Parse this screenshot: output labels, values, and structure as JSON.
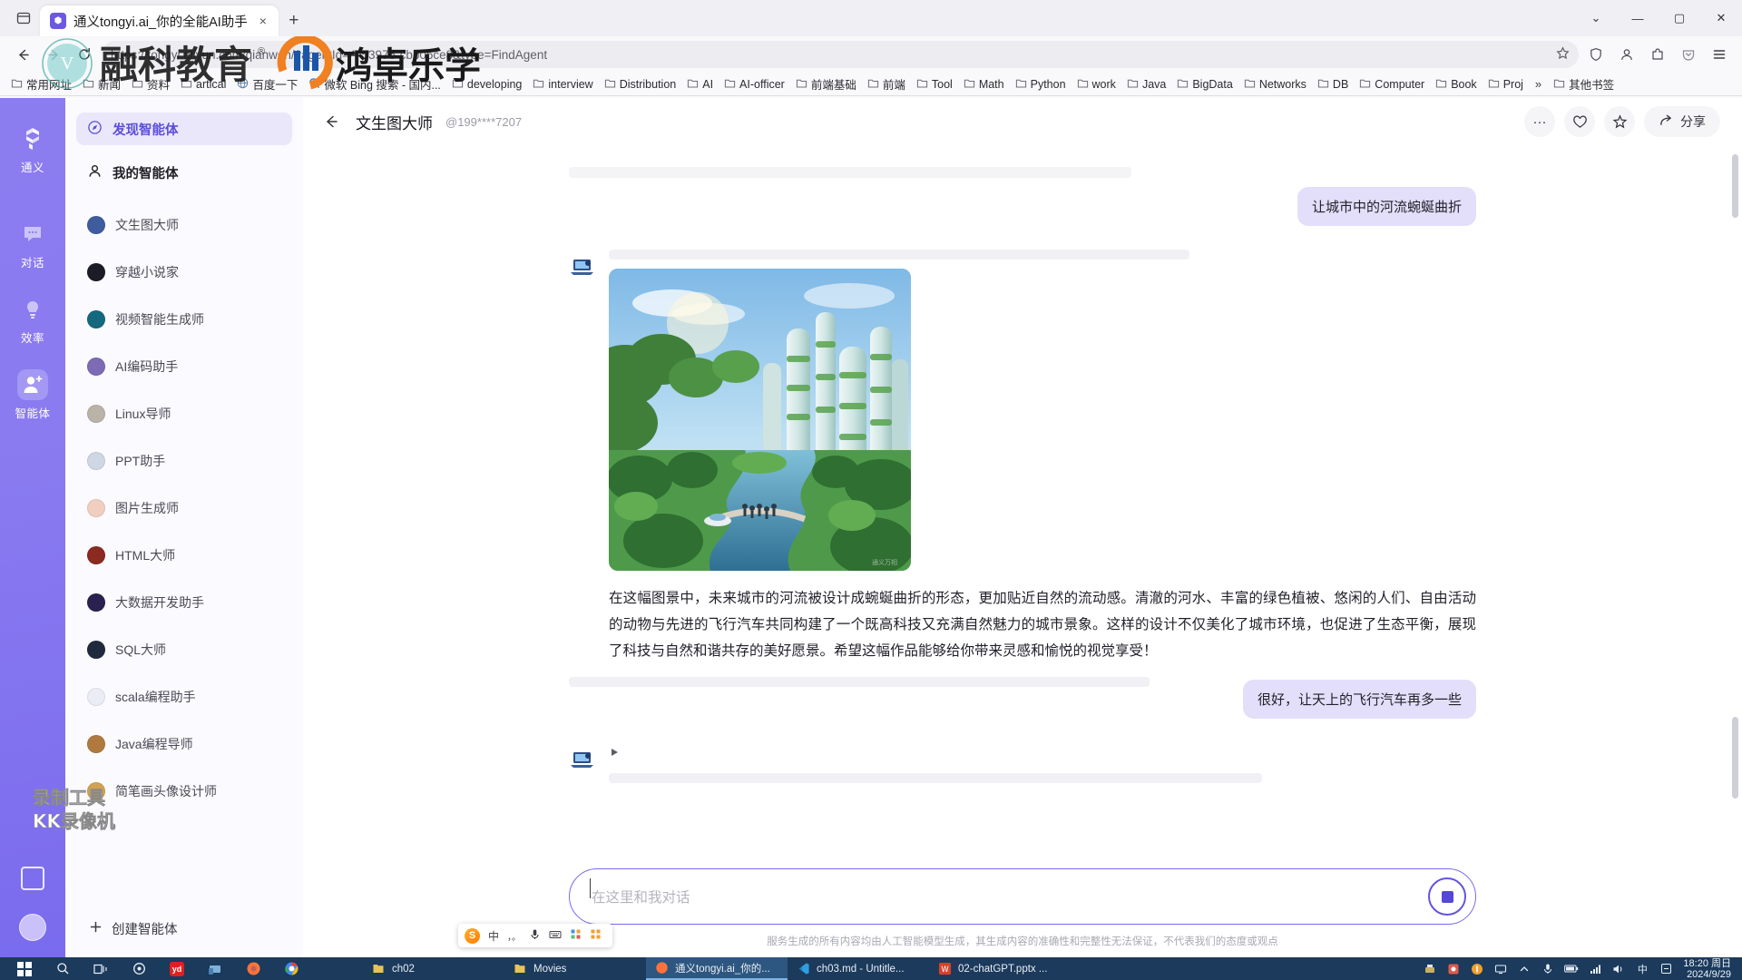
{
  "browser": {
    "tab": {
      "title": "通义tongyi.ai_你的全能AI助手",
      "favicon": "tongyi-icon",
      "close": "×"
    },
    "new_tab": "+",
    "window_controls": {
      "more": "⌄",
      "minimize": "—",
      "maximize": "▢",
      "close": "✕"
    },
    "url": "https://tongyi.aliyun.com/qianwen/?agentId=A-53975-cbb05ce8&type=FindAgent",
    "toolbar_icons": [
      "back-arrow-icon",
      "forward-arrow-icon",
      "reload-icon",
      "bookmark-star-icon",
      "shield-icon",
      "account-icon",
      "extensions-icon",
      "pocket-icon",
      "menu-icon"
    ],
    "bookmarks": [
      {
        "label": "常用网址",
        "icon": "folder-icon"
      },
      {
        "label": "新闻",
        "icon": "folder-icon"
      },
      {
        "label": "资料",
        "icon": "folder-icon"
      },
      {
        "label": "artical",
        "icon": "folder-icon"
      },
      {
        "label": "百度一下",
        "icon": "globe-icon"
      },
      {
        "label": "微软 Bing 搜索 - 国内...",
        "icon": "search-icon"
      },
      {
        "label": "developing",
        "icon": "folder-icon"
      },
      {
        "label": "interview",
        "icon": "folder-icon"
      },
      {
        "label": "Distribution",
        "icon": "folder-icon"
      },
      {
        "label": "AI",
        "icon": "folder-icon"
      },
      {
        "label": "AI-officer",
        "icon": "folder-icon"
      },
      {
        "label": "前端基础",
        "icon": "folder-icon"
      },
      {
        "label": "前端",
        "icon": "folder-icon"
      },
      {
        "label": "Tool",
        "icon": "folder-icon"
      },
      {
        "label": "Math",
        "icon": "folder-icon"
      },
      {
        "label": "Python",
        "icon": "folder-icon"
      },
      {
        "label": "work",
        "icon": "folder-icon"
      },
      {
        "label": "Java",
        "icon": "folder-icon"
      },
      {
        "label": "BigData",
        "icon": "folder-icon"
      },
      {
        "label": "Networks",
        "icon": "folder-icon"
      },
      {
        "label": "DB",
        "icon": "folder-icon"
      },
      {
        "label": "Computer",
        "icon": "folder-icon"
      },
      {
        "label": "Book",
        "icon": "folder-icon"
      },
      {
        "label": "Proj",
        "icon": "folder-icon"
      }
    ],
    "bookmarks_overflow": "»",
    "other_bookmarks": "其他书签"
  },
  "left_rail": {
    "logo_label": "通义",
    "items": [
      {
        "label": "对话",
        "icon": "chat-bubble-icon",
        "active": false
      },
      {
        "label": "效率",
        "icon": "lightbulb-icon",
        "active": false
      },
      {
        "label": "智能体",
        "icon": "agent-person-icon",
        "active": true
      }
    ],
    "bottom": [
      "mobile-icon",
      "user-avatar"
    ]
  },
  "agent_panel": {
    "discover": "发现智能体",
    "mine": "我的智能体",
    "create": "创建智能体",
    "agents": [
      {
        "label": "文生图大师",
        "avatar_color": "#3f5d9e"
      },
      {
        "label": "穿越小说家",
        "avatar_color": "#1c1c28"
      },
      {
        "label": "视频智能生成师",
        "avatar_color": "#14697f"
      },
      {
        "label": "AI编码助手",
        "avatar_color": "#7e6bb5"
      },
      {
        "label": "Linux导师",
        "avatar_color": "#b9b3a8"
      },
      {
        "label": "PPT助手",
        "avatar_color": "#cfd6e4"
      },
      {
        "label": "图片生成师",
        "avatar_color": "#f0cfc0"
      },
      {
        "label": "HTML大师",
        "avatar_color": "#8a2a20"
      },
      {
        "label": "大数据开发助手",
        "avatar_color": "#2b2150"
      },
      {
        "label": "SQL大师",
        "avatar_color": "#1f2a3c"
      },
      {
        "label": "scala编程助手",
        "avatar_color": "#ececf6"
      },
      {
        "label": "Java编程导师",
        "avatar_color": "#b07a3e"
      },
      {
        "label": "简笔画头像设计师",
        "avatar_color": "#d2a152"
      }
    ]
  },
  "chat": {
    "back_icon": "back-arrow-icon",
    "title": "文生图大师",
    "account": "@199****7207",
    "actions": {
      "more": "···",
      "like": "♡",
      "favorite": "☆",
      "share_label": "分享",
      "share_icon": "share-arrow-icon"
    },
    "messages": [
      {
        "role": "user",
        "text": "让城市中的河流蜿蜒曲折"
      },
      {
        "role": "assistant",
        "image_alt": "futuristic green city with winding river",
        "text": "在这幅图景中，未来城市的河流被设计成蜿蜒曲折的形态，更加贴近自然的流动感。清澈的河水、丰富的绿色植被、悠闲的人们、自由活动的动物与先进的飞行汽车共同构建了一个既高科技又充满自然魅力的城市景象。这样的设计不仅美化了城市环境，也促进了生态平衡，展现了科技与自然和谐共存的美好愿景。希望这幅作品能够给你带来灵感和愉悦的视觉享受！"
      },
      {
        "role": "user",
        "text": "很好，让天上的飞行汽车再多一些"
      },
      {
        "role": "assistant",
        "text": ""
      }
    ],
    "composer": {
      "placeholder": "在这里和我对话",
      "send_icon": "stop-record-icon"
    },
    "disclaimer": "服务生成的所有内容均由人工智能模型生成，其生成内容的准确性和完整性无法保证，不代表我们的态度或观点"
  },
  "ime": {
    "lang": "中",
    "punct": "，。",
    "icons": [
      "mic-icon",
      "keyboard-icon",
      "tools-icon",
      "apps-icon"
    ],
    "logo": "S"
  },
  "recorder_watermark": {
    "line1": "录制工具",
    "line2": "KK录像机"
  },
  "taskbar": {
    "system_icons": [
      "start-icon",
      "search-icon",
      "taskview-icon",
      "cortana-icon",
      "youdao-icon",
      "vmware-icon",
      "firefox-icon",
      "chrome-icon"
    ],
    "tasks": [
      {
        "label": "ch02",
        "icon": "folder-icon",
        "active": false
      },
      {
        "label": "Movies",
        "icon": "folder-icon",
        "active": false
      },
      {
        "label": "通义tongyi.ai_你的...",
        "icon": "firefox-icon",
        "active": true
      },
      {
        "label": "ch03.md - Untitle...",
        "icon": "vscode-icon",
        "active": false
      },
      {
        "label": "02-chatGPT.pptx ...",
        "icon": "wps-icon",
        "active": false
      }
    ],
    "tray": [
      "printer-icon",
      "app1-icon",
      "app2-icon",
      "monitor-icon",
      "up-arrow-icon",
      "mic-icon",
      "battery-icon",
      "network-icon",
      "volume-icon",
      "ime-cn-icon",
      "ime-tool-icon"
    ],
    "clock_time": "18:20 周日",
    "clock_date": "2024/9/29"
  },
  "colors": {
    "accent": "#6354e0",
    "rail_gradient_top": "#8b7cf0",
    "rail_gradient_bottom": "#7a6bee",
    "user_bubble": "#e3dffa",
    "panel_bg": "#fbfaff",
    "taskbar": "#1b3a5c"
  }
}
